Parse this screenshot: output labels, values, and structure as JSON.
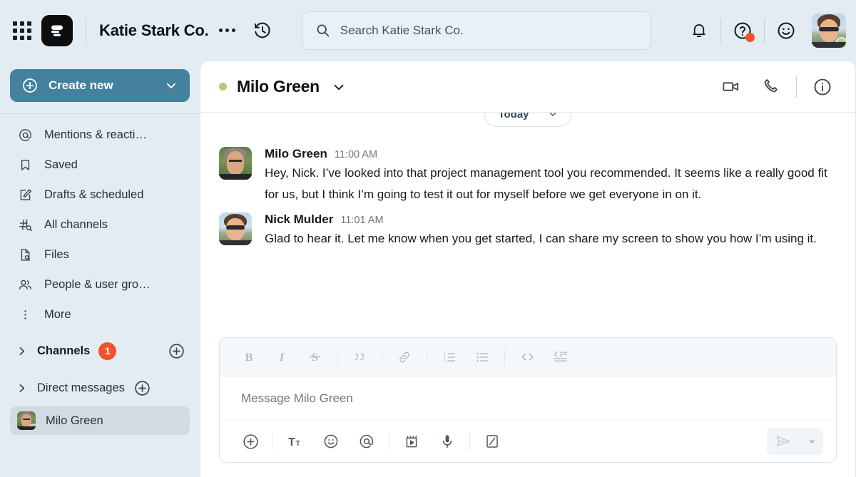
{
  "topbar": {
    "grid_icon": "app-grid-icon",
    "logo_icon": "pumble-logo-icon",
    "org_name": "Katie Stark Co.",
    "more_icon": "ellipsis-icon",
    "history_icon": "history-clock-icon",
    "search": {
      "placeholder": "Search Katie Stark Co.",
      "icon": "search-icon"
    },
    "notifications_icon": "bell-icon",
    "help_icon": "question-circle-icon",
    "help_badge_color": "#f2522b",
    "status_icon": "smiley-face-icon",
    "avatar_name": "Nick Mulder",
    "presence_color": "#a9d36a"
  },
  "sidebar": {
    "create_button": {
      "label": "Create new",
      "icon": "plus-circle-icon",
      "chevron": "chevron-down-icon",
      "color": "#44819e"
    },
    "items": [
      {
        "label": "Mentions & reacti…",
        "icon": "at-icon"
      },
      {
        "label": "Saved",
        "icon": "bookmark-icon"
      },
      {
        "label": "Drafts & scheduled",
        "icon": "pencil-note-icon"
      },
      {
        "label": "All channels",
        "icon": "hash-search-icon"
      },
      {
        "label": "Files",
        "icon": "file-search-icon"
      },
      {
        "label": "People & user gro…",
        "icon": "people-icon"
      },
      {
        "label": "More",
        "icon": "kebab-menu-icon"
      }
    ],
    "sections": [
      {
        "label": "Channels",
        "badge": "1",
        "bold": true,
        "chevron": "chevron-right-icon",
        "add_icon": "plus-circle-icon"
      },
      {
        "label": "Direct messages",
        "badge": null,
        "bold": false,
        "chevron": "chevron-right-icon",
        "add_icon": "plus-circle-icon"
      }
    ],
    "dm": {
      "label": "Milo Green",
      "presence_color": "#a9d36a",
      "selected": true
    }
  },
  "conversation": {
    "name": "Milo Green",
    "presence_color": "#a9d36a",
    "chevron_icon": "chevron-down-icon",
    "actions": [
      {
        "icon": "video-camera-icon",
        "name": "start-video-call-button"
      },
      {
        "icon": "phone-icon",
        "name": "start-audio-call-button"
      },
      {
        "icon": "info-circle-icon",
        "name": "conversation-details-button"
      }
    ],
    "date_divider": {
      "label": "Today",
      "chevron": "chevron-down-icon"
    },
    "messages": [
      {
        "author": "Milo Green",
        "time": "11:00 AM",
        "avatar": "milo",
        "text": "Hey, Nick. I’ve looked into that project management tool you recommended. It seems like a really good fit for us, but I think I’m going to test it out for myself before we get everyone in on it."
      },
      {
        "author": "Nick Mulder",
        "time": "11:01 AM",
        "avatar": "nick",
        "text": "Glad to hear it. Let me know when you get started, I can share my screen to show you how I’m using it."
      }
    ]
  },
  "composer": {
    "placeholder": "Message Milo Green",
    "format_tools": [
      {
        "icon": "bold-icon",
        "name": "bold-button",
        "glyph": "B"
      },
      {
        "icon": "italic-icon",
        "name": "italic-button",
        "glyph": "I"
      },
      {
        "icon": "strikethrough-icon",
        "name": "strikethrough-button",
        "glyph": "S"
      },
      {
        "icon": "blockquote-icon",
        "name": "blockquote-button",
        "glyph": "””"
      },
      {
        "icon": "link-icon",
        "name": "insert-link-button",
        "glyph": "⚭"
      },
      {
        "icon": "ordered-list-icon",
        "name": "ordered-list-button",
        "glyph": ""
      },
      {
        "icon": "bulleted-list-icon",
        "name": "bulleted-list-button",
        "glyph": ""
      },
      {
        "icon": "inline-code-icon",
        "name": "inline-code-button",
        "glyph": "<>"
      },
      {
        "icon": "code-block-icon",
        "name": "code-block-button",
        "glyph": ""
      }
    ],
    "action_tools": [
      {
        "icon": "plus-circle-icon",
        "name": "attach-button"
      },
      {
        "icon": "text-format-icon",
        "name": "text-format-button"
      },
      {
        "icon": "emoji-icon",
        "name": "emoji-picker-button"
      },
      {
        "icon": "mention-icon",
        "name": "mention-button"
      },
      {
        "icon": "video-clip-icon",
        "name": "record-video-clip-button"
      },
      {
        "icon": "microphone-icon",
        "name": "record-audio-clip-button"
      },
      {
        "icon": "draw-icon",
        "name": "whiteboard-button"
      }
    ],
    "send": {
      "icon": "send-paper-plane-icon",
      "chevron": "chevron-down-icon",
      "enabled": false
    }
  }
}
